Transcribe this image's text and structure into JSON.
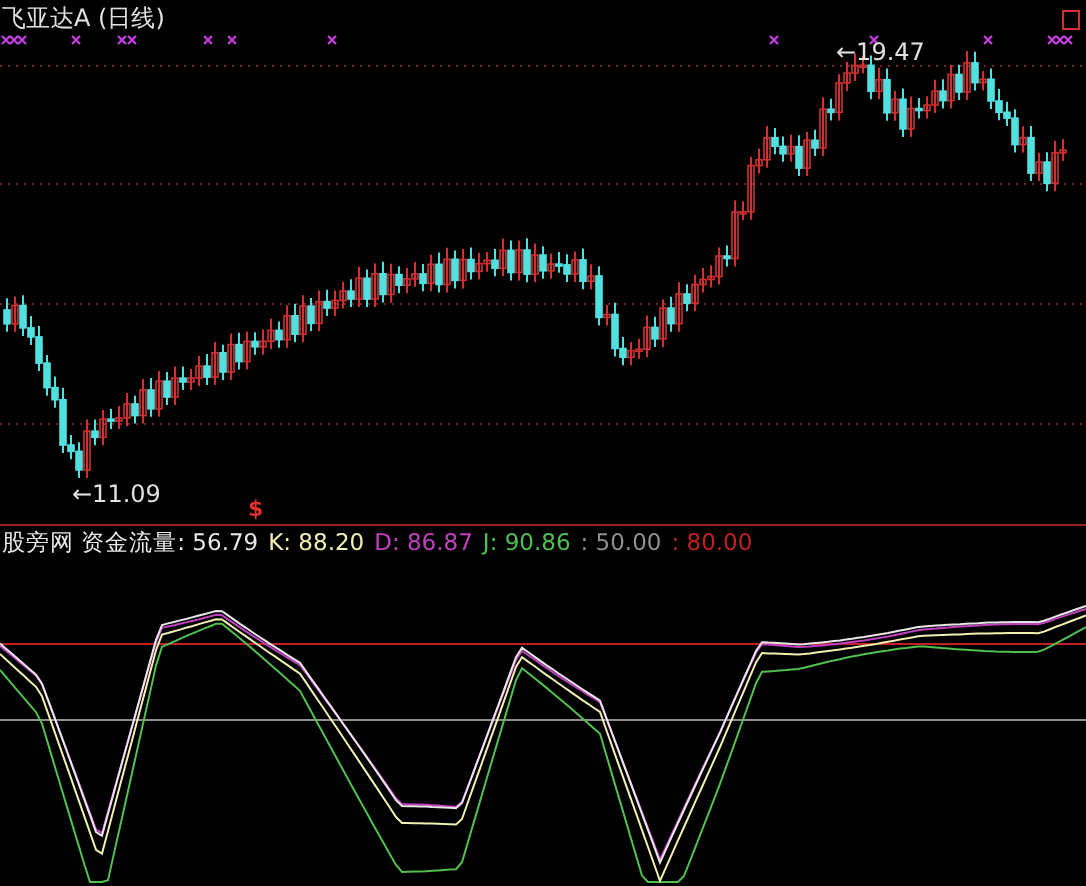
{
  "title": "飞亚达A (日线)",
  "price_chart": {
    "high_label": "←19.47",
    "low_label": "←11.09",
    "signal_label": "$"
  },
  "indicator": {
    "legend": [
      {
        "text": "股旁网 资金流量: 56.79",
        "color": "#e8e8e8"
      },
      {
        "text": "K: 88.20",
        "color": "#f0f0b0"
      },
      {
        "text": "D: 86.87",
        "color": "#c040c0"
      },
      {
        "text": "J: 90.86",
        "color": "#50c050"
      },
      {
        "text": ": 50.00",
        "color": "#909090"
      },
      {
        "text": ": 80.00",
        "color": "#c02020"
      }
    ]
  }
}
